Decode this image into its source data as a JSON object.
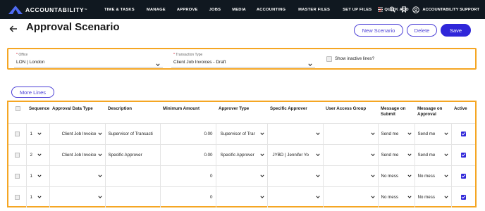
{
  "brand": {
    "name": "ACCOUNTABILITY",
    "trademark": "™"
  },
  "nav": [
    {
      "label": "TIME & TASKS"
    },
    {
      "label": "MANAGE"
    },
    {
      "label": "APPROVE"
    },
    {
      "label": "JOBS"
    },
    {
      "label": "MEDIA"
    },
    {
      "label": "ACCOUNTING"
    },
    {
      "label": "MASTER FILES"
    },
    {
      "label": "SET UP FILES"
    },
    {
      "label": "QUICK ADD"
    }
  ],
  "user": {
    "name": "ACCOUNTABILITY SUPPORT"
  },
  "icons": {
    "back": "arrow-left-icon",
    "filter": "sliders-icon",
    "search": "search-icon",
    "bookmark": "bookmark-icon",
    "user": "user-circle-icon"
  },
  "page": {
    "title": "Approval Scenario"
  },
  "buttons": {
    "new_scenario": "New Scenario",
    "delete": "Delete",
    "save": "Save",
    "more_lines": "More Lines"
  },
  "filters": {
    "office": {
      "label": "Office",
      "value": "LON | London"
    },
    "transaction_type": {
      "label": "Transaction Type",
      "value": "Client Job Invoices - Draft"
    },
    "show_inactive": {
      "label": "Show inactive lines?",
      "checked": false
    }
  },
  "table": {
    "headers": [
      "",
      "Sequence",
      "Approval Data Type",
      "Description",
      "Minimum Amount",
      "Approver Type",
      "Specific Approver",
      "User Access Group",
      "Message on Submit",
      "Message on Approval",
      "Active"
    ],
    "rows": [
      {
        "sequence": "1",
        "data_type": "Client Job Invoice",
        "description": "Supervisor of Transacti",
        "min_amount": "0.00",
        "approver_type": "Supervisor of Trar",
        "specific_approver": "",
        "access_group": "",
        "msg_submit": "Send me",
        "msg_approval": "Send me",
        "active": true
      },
      {
        "sequence": "2",
        "data_type": "Client Job Invoice",
        "description": "Specific Approver",
        "min_amount": "0.00",
        "approver_type": "Specific Approver",
        "specific_approver": "JYBD | Jennifer Yo",
        "access_group": "",
        "msg_submit": "Send me",
        "msg_approval": "Send me",
        "active": true
      },
      {
        "sequence": "1",
        "data_type": "",
        "description": "",
        "min_amount": "0",
        "approver_type": "",
        "specific_approver": "",
        "access_group": "",
        "msg_submit": "No mess",
        "msg_approval": "No mess",
        "active": true
      },
      {
        "sequence": "1",
        "data_type": "",
        "description": "",
        "min_amount": "0",
        "approver_type": "",
        "specific_approver": "",
        "access_group": "",
        "msg_submit": "No mess",
        "msg_approval": "No mess",
        "active": true
      }
    ]
  },
  "colors": {
    "nav_bg": "#101820",
    "accent": "#2f26d9",
    "highlight": "#f5a623",
    "logo": "#4f6bf2"
  }
}
